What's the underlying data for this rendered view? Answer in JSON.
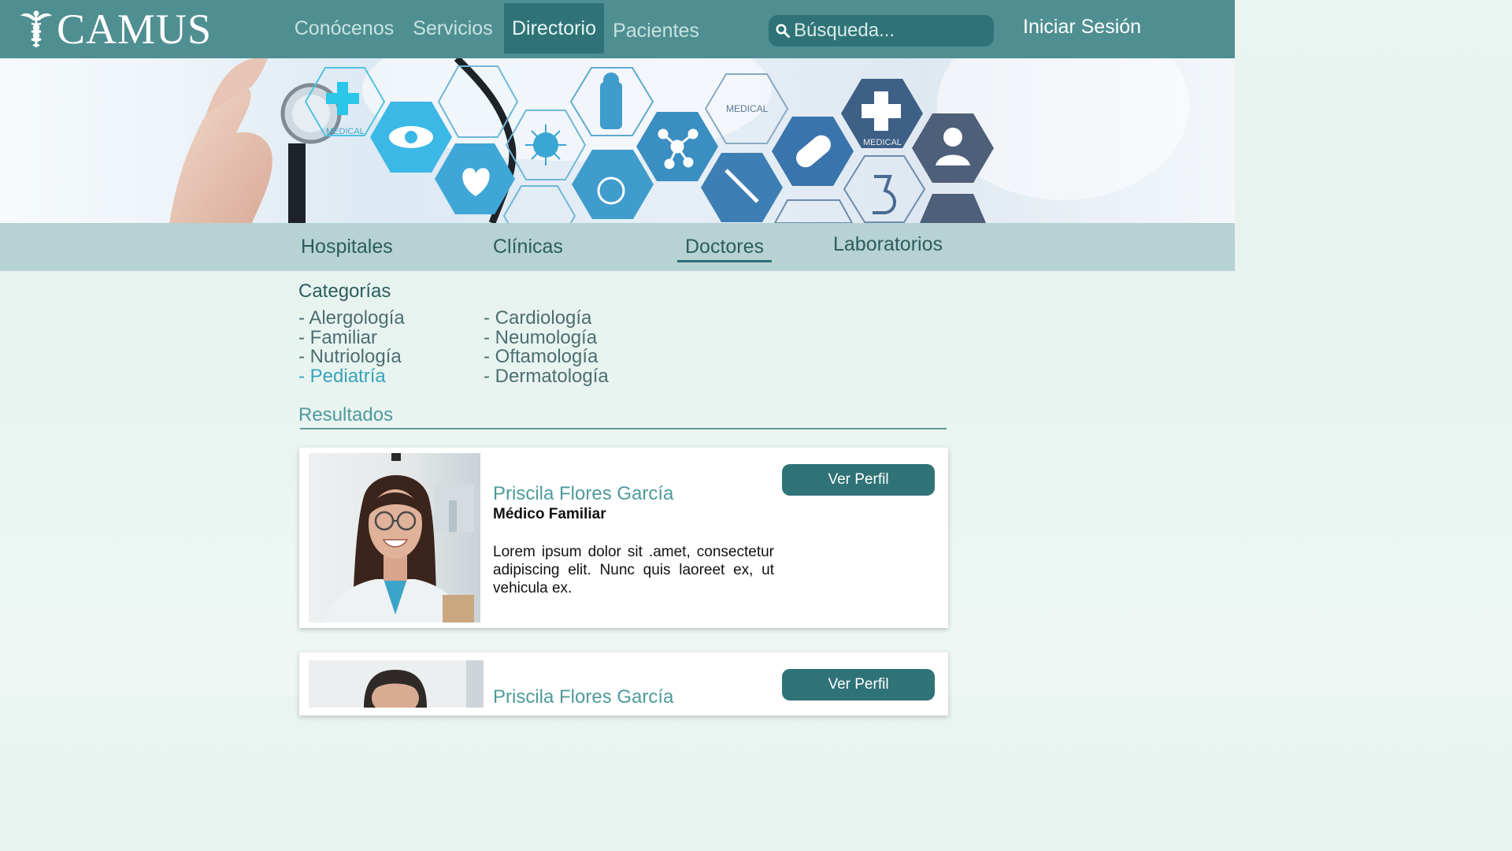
{
  "header": {
    "logo_text": "CAMUS",
    "nav": [
      {
        "label": "Conócenos"
      },
      {
        "label": "Servicios"
      },
      {
        "label": "Directorio"
      },
      {
        "label": "Pacientes"
      }
    ],
    "search_placeholder": "Búsqueda...",
    "login_label": "Iniciar Sesión"
  },
  "hero": {
    "badges": [
      "MEDICAL",
      "MEDICAL",
      "MEDICAL"
    ]
  },
  "tabs": [
    {
      "label": "Hospitales"
    },
    {
      "label": "Clínicas"
    },
    {
      "label": "Doctores"
    },
    {
      "label": "Laboratorios"
    }
  ],
  "categories": {
    "title": "Categorías",
    "left": [
      "- Alergología",
      "- Familiar",
      "- Nutriología",
      "- Pediatría"
    ],
    "right": [
      "- Cardiología",
      "- Neumología",
      "- Oftamología",
      "- Dermatología"
    ]
  },
  "results": {
    "title": "Resultados",
    "cards": [
      {
        "name": "Priscila Flores García",
        "role": "Médico Familiar",
        "description": "Lorem ipsum dolor sit .amet, consectetur adipiscing elit. Nunc quis laoreet ex, ut vehicula ex.",
        "button": "Ver Perfil"
      },
      {
        "name": "Priscila Flores García",
        "button": "Ver Perfil"
      }
    ]
  },
  "colors": {
    "header": "#4f8f92",
    "header_active": "#2f7377",
    "tab_strip": "#b6d2d2",
    "accent": "#4f9a9c",
    "active_category": "#38a3b8"
  }
}
